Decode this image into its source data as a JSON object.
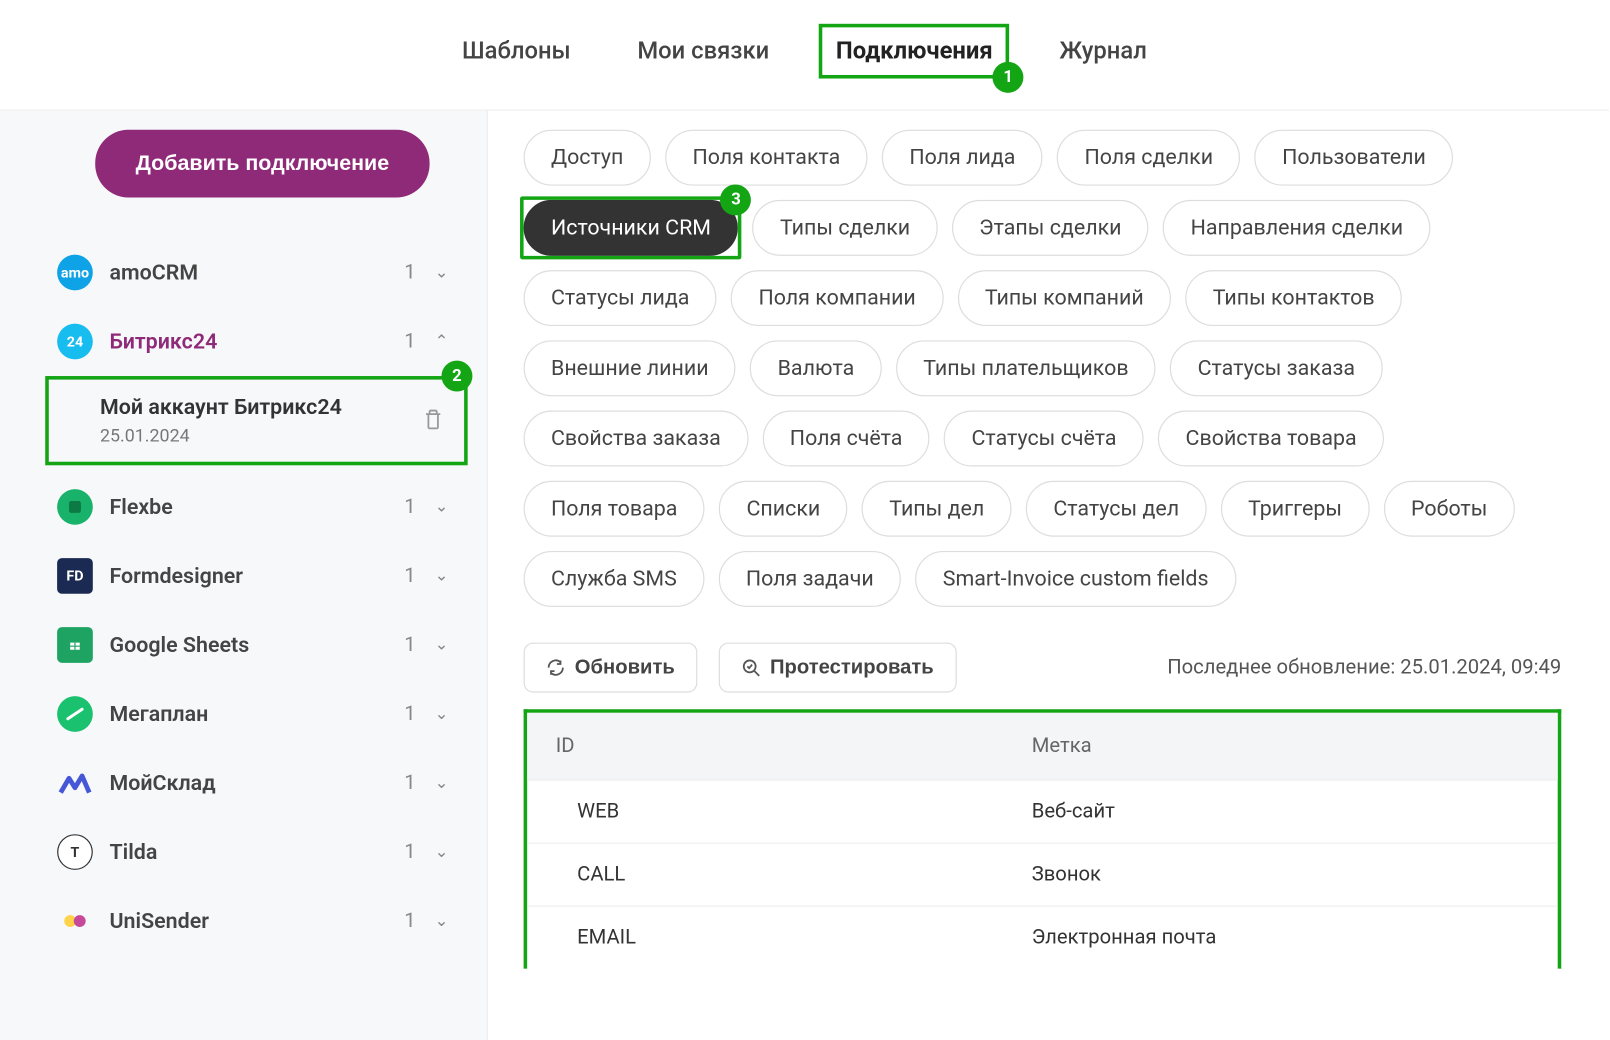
{
  "nav": {
    "templates": "Шаблоны",
    "myflows": "Мои связки",
    "connections": "Подключения",
    "journal": "Журнал"
  },
  "badges": {
    "nav": "1",
    "account": "2",
    "chip": "3"
  },
  "sidebar": {
    "add_button": "Добавить подключение",
    "items": [
      {
        "label": "amoCRM",
        "count": "1"
      },
      {
        "label": "Битрикс24",
        "count": "1"
      },
      {
        "label": "Flexbe",
        "count": "1"
      },
      {
        "label": "Formdesigner",
        "count": "1"
      },
      {
        "label": "Google Sheets",
        "count": "1"
      },
      {
        "label": "Мегаплан",
        "count": "1"
      },
      {
        "label": "МойСклад",
        "count": "1"
      },
      {
        "label": "Tilda",
        "count": "1"
      },
      {
        "label": "UniSender",
        "count": "1"
      }
    ],
    "account": {
      "title": "Мой аккаунт Битрикс24",
      "date": "25.01.2024"
    }
  },
  "chips": [
    "Доступ",
    "Поля контакта",
    "Поля лида",
    "Поля сделки",
    "Пользователи",
    "Источники CRM",
    "Типы сделки",
    "Этапы сделки",
    "Направления сделки",
    "Статусы лида",
    "Поля компании",
    "Типы компаний",
    "Типы контактов",
    "Внешние линии",
    "Валюта",
    "Типы плательщиков",
    "Статусы заказа",
    "Свойства заказа",
    "Поля счёта",
    "Статусы счёта",
    "Свойства товара",
    "Поля товара",
    "Списки",
    "Типы дел",
    "Статусы дел",
    "Триггеры",
    "Роботы",
    "Служба SMS",
    "Поля задачи",
    "Smart-Invoice custom fields"
  ],
  "active_chip_index": 5,
  "toolbar": {
    "refresh": "Обновить",
    "test": "Протестировать",
    "last_update": "Последнее обновление: 25.01.2024, 09:49"
  },
  "table": {
    "headers": {
      "id": "ID",
      "label": "Метка"
    },
    "rows": [
      {
        "id": "WEB",
        "label": "Веб-сайт"
      },
      {
        "id": "CALL",
        "label": "Звонок"
      },
      {
        "id": "EMAIL",
        "label": "Электронная почта"
      }
    ]
  },
  "colors": {
    "amocrm": "#0ea3e6",
    "bitrix": "#18bdf0",
    "flexbe": "#19b26b",
    "formdesigner": "#1b2a52",
    "gsheets": "#1ea362",
    "megaplan": "#1ac16f",
    "moysklad": "#4556d6",
    "tilda": "#ffffff",
    "unisender": "#ffd24a"
  }
}
